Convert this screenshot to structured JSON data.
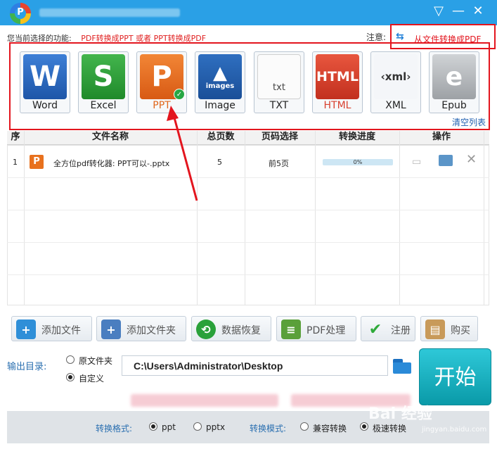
{
  "header": {
    "logo_letter": "P",
    "controls": {
      "menu_icon": "chevron-down-icon",
      "minimize": "—",
      "close": "✕"
    }
  },
  "feature": {
    "label": "您当前选择的功能:",
    "value": "PDF转换成PPT 或者 PPT转换成PDF"
  },
  "notice": {
    "label": "注意:",
    "link": "从文件转换成PDF",
    "arrows": "⇆"
  },
  "formats": [
    {
      "name": "Word",
      "glyph": "W",
      "color": "#2b65b8"
    },
    {
      "name": "Excel",
      "glyph": "S",
      "color": "#2e9a3a"
    },
    {
      "name": "PPT",
      "glyph": "P",
      "color": "#e0661a",
      "selected": true
    },
    {
      "name": "Image",
      "glyph": "images",
      "color": "#1d5fa8"
    },
    {
      "name": "TXT",
      "glyph": "txt",
      "color": "#f0f0f0"
    },
    {
      "name": "HTML",
      "glyph": "HTML",
      "color": "#d8412f"
    },
    {
      "name": "XML",
      "glyph": "xml",
      "color": "#eef2f7"
    },
    {
      "name": "Epub",
      "glyph": "e",
      "color": "#b8bcc0"
    }
  ],
  "clear_list": "清空列表",
  "table": {
    "columns": [
      "序",
      "文件名称",
      "总页数",
      "页码选择",
      "转换进度",
      "操作"
    ],
    "rows": [
      {
        "index": "1",
        "file": "全方位pdf转化器: PPT可以-.pptx",
        "pages": "5",
        "range": "前5页",
        "progress": "0%",
        "progress_value": 0
      }
    ]
  },
  "actions": [
    {
      "label": "添加文件",
      "icon": "add-file-icon",
      "color": "#3a9ad8",
      "glyph": "+"
    },
    {
      "label": "添加文件夹",
      "icon": "add-folder-icon",
      "color": "#3a7fc8",
      "glyph": "+"
    },
    {
      "label": "数据恢复",
      "icon": "restore-icon",
      "color": "#2aa13a",
      "glyph": "⟲"
    },
    {
      "label": "PDF处理",
      "icon": "document-icon",
      "color": "#5a9a3a",
      "glyph": "≡"
    },
    {
      "label": "注册",
      "icon": "checkmark-icon",
      "color": "#2faa3a",
      "glyph": "✔"
    },
    {
      "label": "购买",
      "icon": "shopping-bag-icon",
      "color": "#c89a5a",
      "glyph": "▤"
    }
  ],
  "output": {
    "label": "输出目录:",
    "option_source": "原文件夹",
    "option_custom": "自定义",
    "path": "C:\\Users\\Administrator\\Desktop"
  },
  "start_label": "开始",
  "footer": {
    "format_label": "转换格式:",
    "format_ppt": "ppt",
    "format_pptx": "pptx",
    "mode_label": "转换模式:",
    "mode_compat": "兼容转换",
    "mode_fast": "极速转换"
  },
  "watermark": {
    "brand": "Bai  经验",
    "sub": "jingyan.baidu.com"
  }
}
